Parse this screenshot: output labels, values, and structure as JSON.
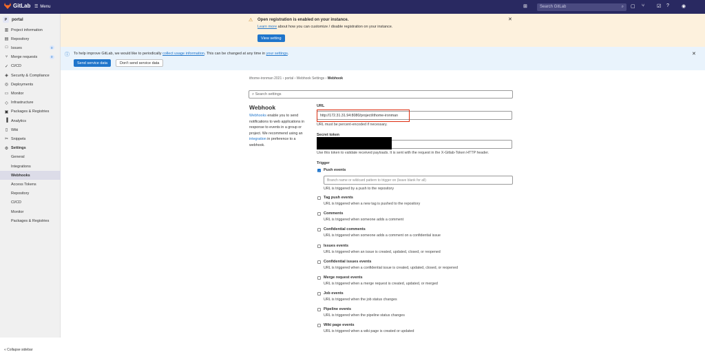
{
  "topbar": {
    "brand": "GitLab",
    "menu_label": "Menu",
    "search_placeholder": "Search GitLab",
    "search_shortcut": "/",
    "icons": [
      "plus-icon",
      "issues-icon",
      "merge-request-icon",
      "todo-icon",
      "help-icon",
      "avatar"
    ]
  },
  "sidebar": {
    "project_initial": "P",
    "project_name": "portal",
    "items": [
      {
        "icon": "▥",
        "label": "Project information"
      },
      {
        "icon": "▤",
        "label": "Repository"
      },
      {
        "icon": "□",
        "label": "Issues",
        "count": "0"
      },
      {
        "icon": "⑂",
        "label": "Merge requests",
        "count": "0"
      },
      {
        "icon": "✓",
        "label": "CI/CD"
      },
      {
        "icon": "◈",
        "label": "Security & Compliance"
      },
      {
        "icon": "◎",
        "label": "Deployments"
      },
      {
        "icon": "▭",
        "label": "Monitor"
      },
      {
        "icon": "◇",
        "label": "Infrastructure"
      },
      {
        "icon": "▣",
        "label": "Packages & Registries"
      },
      {
        "icon": "▐",
        "label": "Analytics"
      },
      {
        "icon": "▯",
        "label": "Wiki"
      },
      {
        "icon": "✂",
        "label": "Snippets"
      },
      {
        "icon": "⚙",
        "label": "Settings"
      }
    ],
    "settings_sub": [
      "General",
      "Integrations",
      "Webhooks",
      "Access Tokens",
      "Repository",
      "CI/CD",
      "Monitor",
      "Packages & Registries"
    ],
    "collapse_label": "Collapse sidebar"
  },
  "registration_alert": {
    "title": "Open registration is enabled on your instance.",
    "link": "Learn more",
    "text": " about how you can customize / disable registration on your instance.",
    "button": "View setting"
  },
  "usage_ping": {
    "text1": "To help improve GitLab, we would like to periodically ",
    "link1": "collect usage information",
    "text2": ". This can be changed at any time in ",
    "link2": "your settings",
    "text3": ".",
    "send_button": "Send service data",
    "dont_button": "Don't send service data"
  },
  "breadcrumb": [
    "ithome-ironman 2021",
    "portal",
    "Webhook Settings",
    "Webhook"
  ],
  "search_settings_placeholder": "Search settings",
  "webhook": {
    "title": "Webhook",
    "desc_link1": "Webhooks",
    "desc1": " enable you to send notifications to web applications in response to events in a group or project. We recommend using an ",
    "desc_link2": "integration",
    "desc2": " in preference to a webhook.",
    "url_label": "URL",
    "url_value": "http://172.31.31.94:8080/project/ithome-ironman",
    "url_help": "URL must be percent-encoded if necessary.",
    "token_label": "Secret token",
    "token_help": "Use this token to validate received payloads. It is sent with the request in the X-Gitlab-Token HTTP header.",
    "trigger_label": "Trigger",
    "branch_placeholder": "Branch name or wildcard pattern to trigger on (leave blank for all)",
    "triggers": [
      {
        "name": "Push events",
        "desc": "URL is triggered by a push to the repository",
        "checked": true
      },
      {
        "name": "Tag push events",
        "desc": "URL is triggered when a new tag is pushed to the repository",
        "checked": false
      },
      {
        "name": "Comments",
        "desc": "URL is triggered when someone adds a comment",
        "checked": false
      },
      {
        "name": "Confidential comments",
        "desc": "URL is triggered when someone adds a comment on a confidential issue",
        "checked": false
      },
      {
        "name": "Issues events",
        "desc": "URL is triggered when an issue is created, updated, closed, or reopened",
        "checked": false
      },
      {
        "name": "Confidential issues events",
        "desc": "URL is triggered when a confidential issue is created, updated, closed, or reopened",
        "checked": false
      },
      {
        "name": "Merge request events",
        "desc": "URL is triggered when a merge request is created, updated, or merged",
        "checked": false
      },
      {
        "name": "Job events",
        "desc": "URL is triggered when the job status changes",
        "checked": false
      },
      {
        "name": "Pipeline events",
        "desc": "URL is triggered when the pipeline status changes",
        "checked": false
      },
      {
        "name": "Wiki page events",
        "desc": "URL is triggered when a wiki page is created or updated",
        "checked": false
      }
    ]
  },
  "colors": {
    "topbar": "#292961",
    "accent": "#1f75cb",
    "alert_bg": "#fdf1dd",
    "info_bg": "#e9f3fc",
    "highlight": "#dd2b0e"
  }
}
